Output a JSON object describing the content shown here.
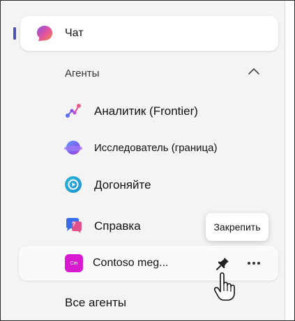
{
  "chat": {
    "label": "Чат",
    "icon": "copilot-chat-icon"
  },
  "agents_section": {
    "label": "Агенты",
    "collapse_icon": "chevron-up-icon"
  },
  "agents": [
    {
      "label": "Аналитик (Frontier)",
      "icon": "analyst-icon"
    },
    {
      "label": "Исследователь (граница)",
      "icon": "researcher-icon"
    },
    {
      "label": "Догоняйте",
      "icon": "catch-up-icon"
    },
    {
      "label": "Справка",
      "icon": "help-icon"
    }
  ],
  "hovered_agent": {
    "label": "Contoso meg...",
    "badge": "Cm",
    "pin_tooltip": "Закрепить"
  },
  "all_agents": {
    "label": "Все агенты"
  },
  "colors": {
    "accent": "#4f52b2",
    "contoso": "#d81ad0"
  }
}
